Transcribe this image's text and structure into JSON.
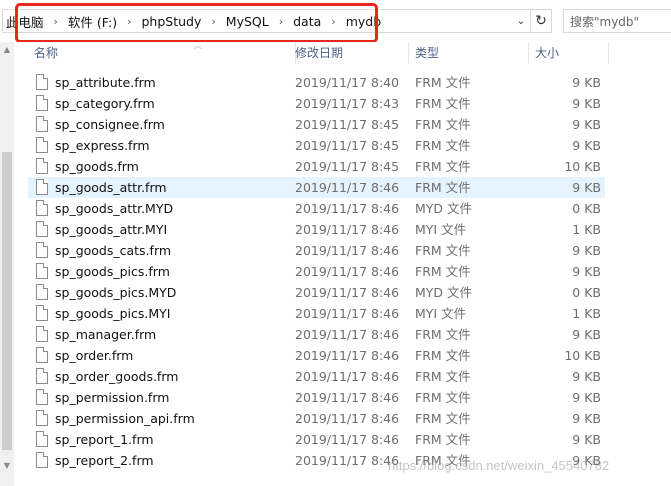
{
  "breadcrumb": {
    "items": [
      "此电脑",
      "软件 (F:)",
      "phpStudy",
      "MySQL",
      "data",
      "mydb"
    ],
    "separator": "›"
  },
  "address_controls": {
    "dropdown_glyph": "⌄",
    "refresh_glyph": "↻"
  },
  "search": {
    "placeholder": "搜索\"mydb\""
  },
  "columns": {
    "name": "名称",
    "date": "修改日期",
    "type": "类型",
    "size": "大小"
  },
  "files": [
    {
      "name": "sp_attribute.frm",
      "date": "2019/11/17 8:40",
      "type": "FRM 文件",
      "size": "9 KB"
    },
    {
      "name": "sp_category.frm",
      "date": "2019/11/17 8:43",
      "type": "FRM 文件",
      "size": "9 KB"
    },
    {
      "name": "sp_consignee.frm",
      "date": "2019/11/17 8:45",
      "type": "FRM 文件",
      "size": "9 KB"
    },
    {
      "name": "sp_express.frm",
      "date": "2019/11/17 8:45",
      "type": "FRM 文件",
      "size": "9 KB"
    },
    {
      "name": "sp_goods.frm",
      "date": "2019/11/17 8:45",
      "type": "FRM 文件",
      "size": "10 KB"
    },
    {
      "name": "sp_goods_attr.frm",
      "date": "2019/11/17 8:46",
      "type": "FRM 文件",
      "size": "9 KB"
    },
    {
      "name": "sp_goods_attr.MYD",
      "date": "2019/11/17 8:46",
      "type": "MYD 文件",
      "size": "0 KB"
    },
    {
      "name": "sp_goods_attr.MYI",
      "date": "2019/11/17 8:46",
      "type": "MYI 文件",
      "size": "1 KB"
    },
    {
      "name": "sp_goods_cats.frm",
      "date": "2019/11/17 8:46",
      "type": "FRM 文件",
      "size": "9 KB"
    },
    {
      "name": "sp_goods_pics.frm",
      "date": "2019/11/17 8:46",
      "type": "FRM 文件",
      "size": "9 KB"
    },
    {
      "name": "sp_goods_pics.MYD",
      "date": "2019/11/17 8:46",
      "type": "MYD 文件",
      "size": "0 KB"
    },
    {
      "name": "sp_goods_pics.MYI",
      "date": "2019/11/17 8:46",
      "type": "MYI 文件",
      "size": "1 KB"
    },
    {
      "name": "sp_manager.frm",
      "date": "2019/11/17 8:46",
      "type": "FRM 文件",
      "size": "9 KB"
    },
    {
      "name": "sp_order.frm",
      "date": "2019/11/17 8:46",
      "type": "FRM 文件",
      "size": "10 KB"
    },
    {
      "name": "sp_order_goods.frm",
      "date": "2019/11/17 8:46",
      "type": "FRM 文件",
      "size": "9 KB"
    },
    {
      "name": "sp_permission.frm",
      "date": "2019/11/17 8:46",
      "type": "FRM 文件",
      "size": "9 KB"
    },
    {
      "name": "sp_permission_api.frm",
      "date": "2019/11/17 8:46",
      "type": "FRM 文件",
      "size": "9 KB"
    },
    {
      "name": "sp_report_1.frm",
      "date": "2019/11/17 8:46",
      "type": "FRM 文件",
      "size": "9 KB"
    },
    {
      "name": "sp_report_2.frm",
      "date": "2019/11/17 8:46",
      "type": "FRM 文件",
      "size": "9 KB"
    }
  ],
  "hovered_row": "sp_goods_attr.frm",
  "watermark": "https://blog.csdn.net/weixin_45540782",
  "colors": {
    "highlight_box": "#e8261d",
    "hover_row": "#e5f3ff",
    "header_text": "#4d6185"
  }
}
